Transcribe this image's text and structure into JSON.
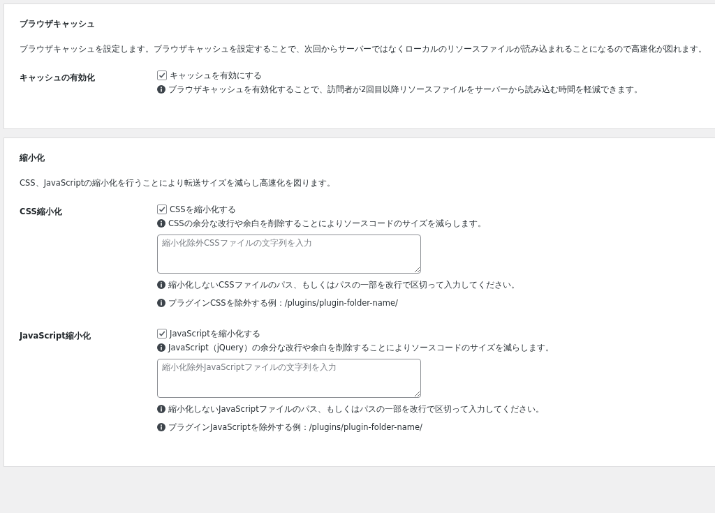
{
  "panels": [
    {
      "title": "ブラウザキャッシュ",
      "description": "ブラウザキャッシュを設定します。ブラウザキャッシュを設定することで、次回からサーバーではなくローカルのリソースファイルが読み込まれることになるので高速化が図れます。",
      "rows": [
        {
          "label": "キャッシュの有効化",
          "items": [
            {
              "kind": "checkbox",
              "label": "キャッシュを有効にする",
              "checked": true
            },
            {
              "kind": "note",
              "text": "ブラウザキャッシュを有効化することで、訪問者が2回目以降リソースファイルをサーバーから読み込む時間を軽減できます。"
            }
          ]
        }
      ]
    },
    {
      "title": "縮小化",
      "description": "CSS、JavaScriptの縮小化を行うことにより転送サイズを減らし高速化を図ります。",
      "rows": [
        {
          "label": "CSS縮小化",
          "items": [
            {
              "kind": "checkbox",
              "label": "CSSを縮小化する",
              "checked": true
            },
            {
              "kind": "note",
              "text": "CSSの余分な改行や余白を削除することによりソースコードのサイズを減らします。"
            },
            {
              "kind": "textarea",
              "placeholder": "縮小化除外CSSファイルの文字列を入力"
            },
            {
              "kind": "note",
              "text": "縮小化しないCSSファイルのパス、もしくはパスの一部を改行で区切って入力してください。"
            },
            {
              "kind": "note",
              "text": "プラグインCSSを除外する例：/plugins/plugin-folder-name/"
            }
          ]
        },
        {
          "label": "JavaScript縮小化",
          "items": [
            {
              "kind": "checkbox",
              "label": "JavaScriptを縮小化する",
              "checked": true
            },
            {
              "kind": "note",
              "text": "JavaScript（jQuery）の余分な改行や余白を削除することによりソースコードのサイズを減らします。"
            },
            {
              "kind": "textarea",
              "placeholder": "縮小化除外JavaScriptファイルの文字列を入力"
            },
            {
              "kind": "note",
              "text": "縮小化しないJavaScriptファイルのパス、もしくはパスの一部を改行で区切って入力してください。"
            },
            {
              "kind": "note",
              "text": "プラグインJavaScriptを除外する例：/plugins/plugin-folder-name/"
            }
          ]
        }
      ]
    }
  ]
}
